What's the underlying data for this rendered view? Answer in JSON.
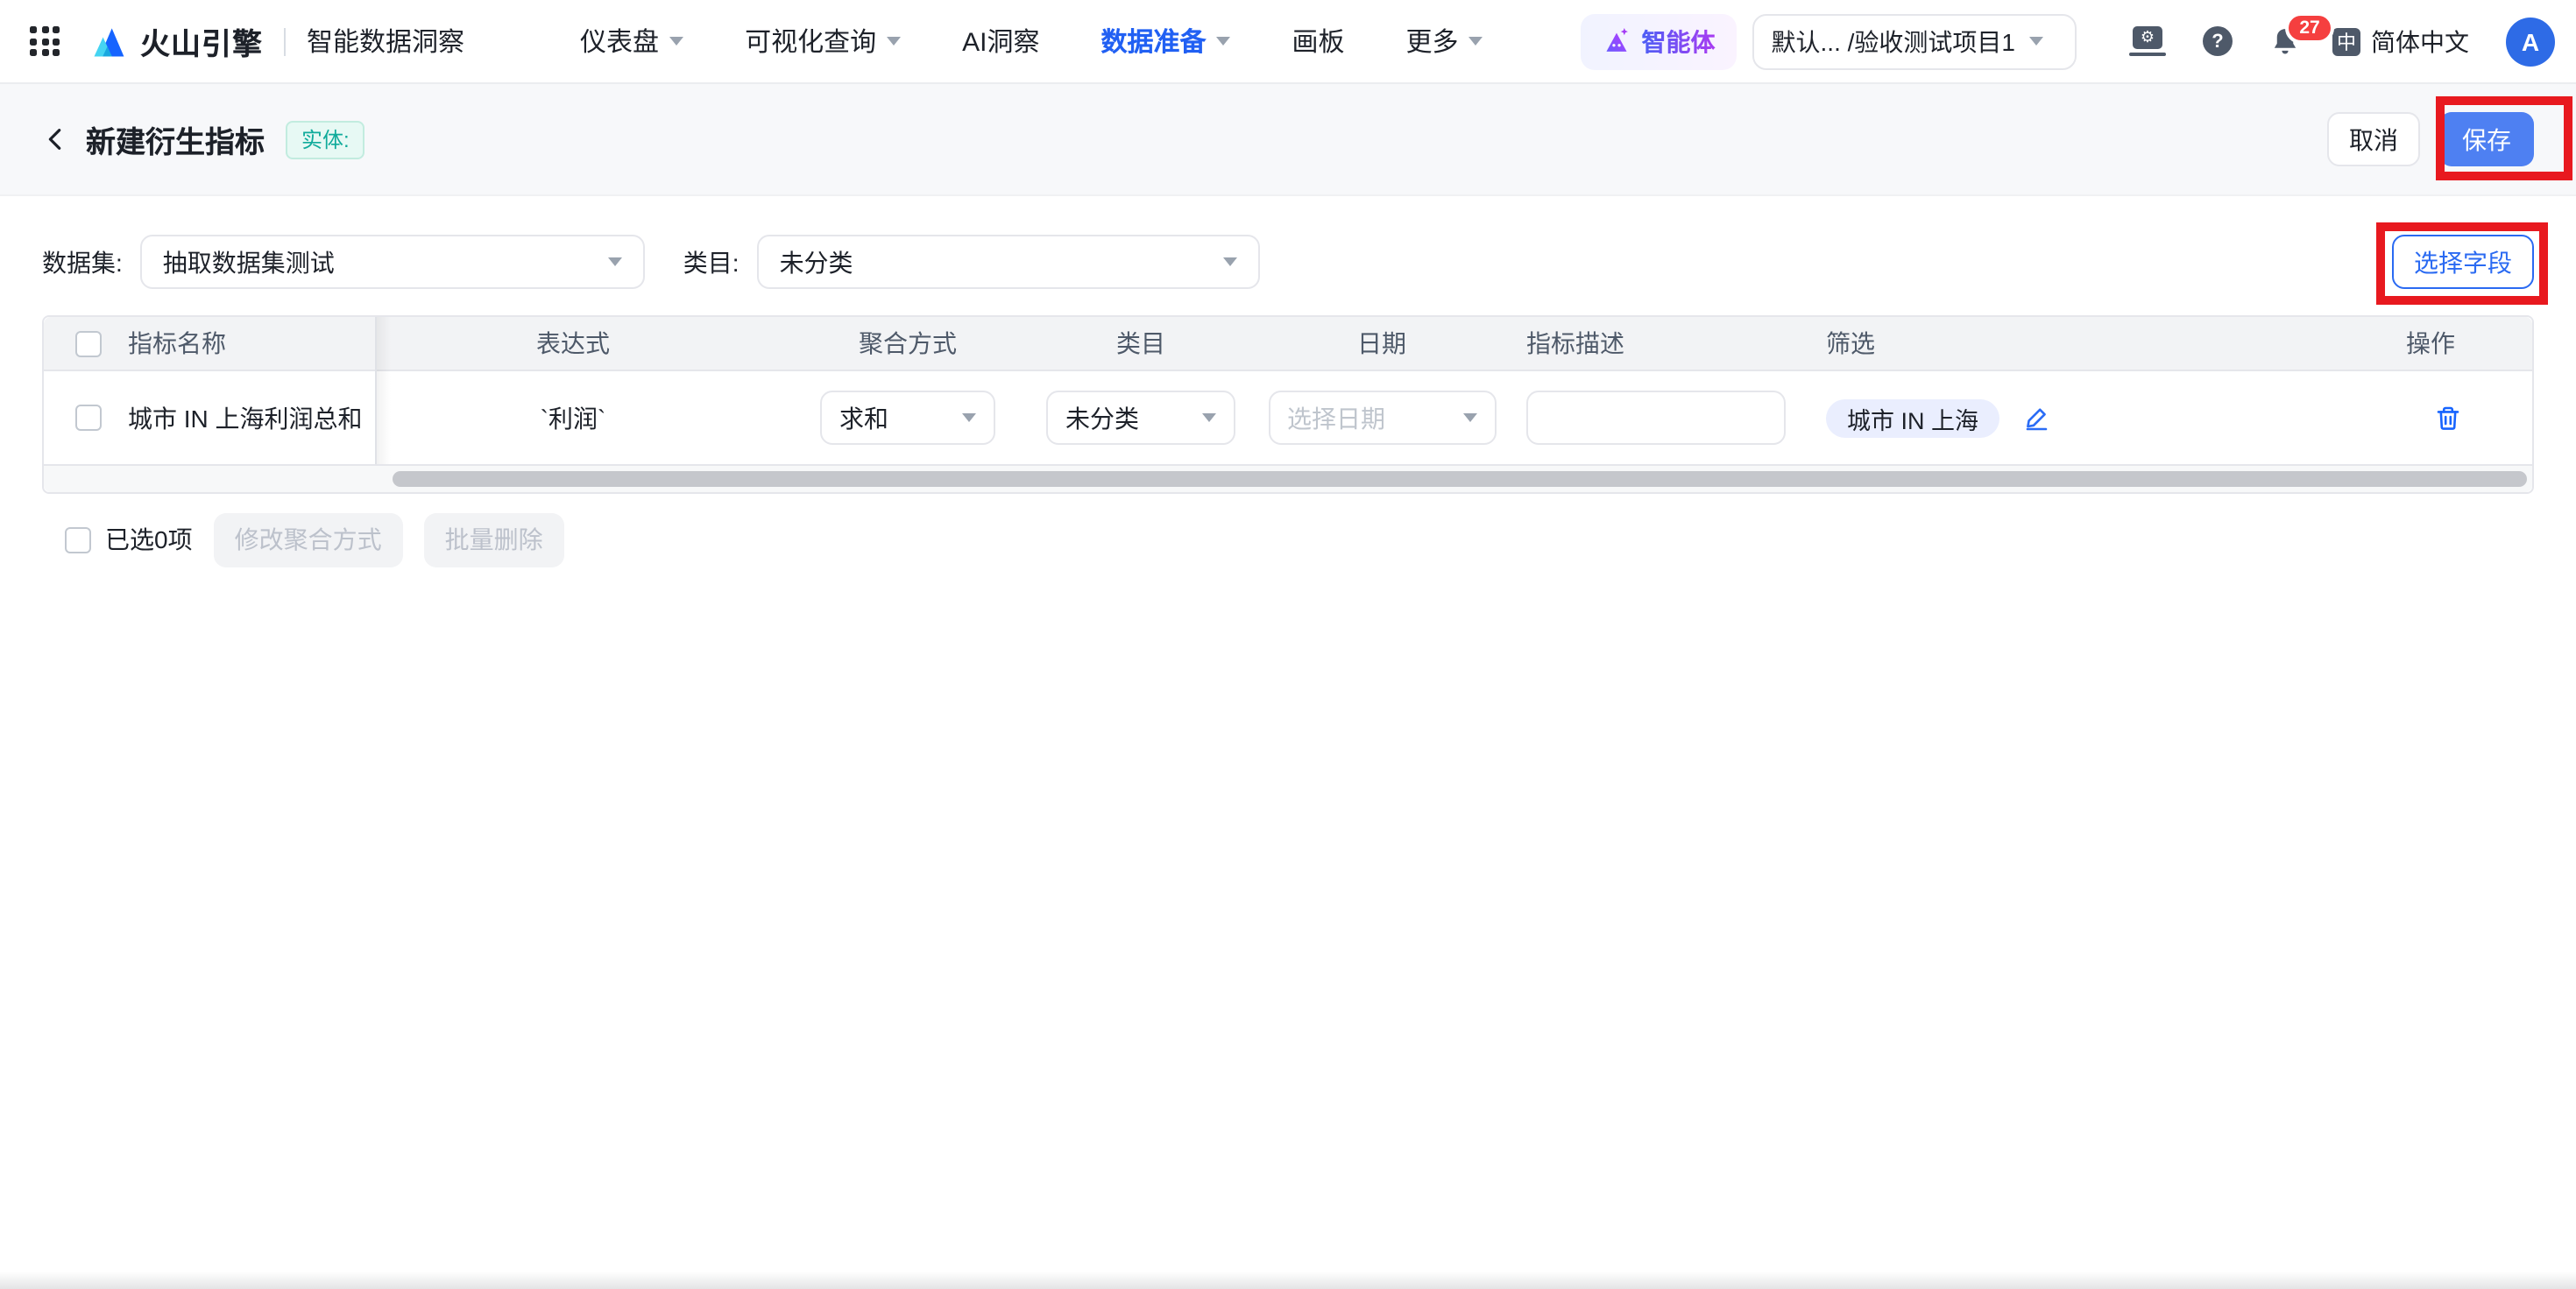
{
  "nav": {
    "brand": "火山引擎",
    "product": "智能数据洞察",
    "items": [
      {
        "label": "仪表盘"
      },
      {
        "label": "可视化查询"
      },
      {
        "label": "AI洞察"
      },
      {
        "label": "数据准备"
      },
      {
        "label": "画板"
      },
      {
        "label": "更多"
      }
    ],
    "agent_label": "智能体",
    "project_selector": "默认... /验收测试项目1",
    "notification_count": "27",
    "lang_chip": "中",
    "lang_label": "简体中文",
    "avatar_initial": "A"
  },
  "header": {
    "title": "新建衍生指标",
    "entity_badge": "实体:",
    "cancel_label": "取消",
    "save_label": "保存"
  },
  "filters": {
    "dataset_label": "数据集:",
    "dataset_value": "抽取数据集测试",
    "category_label": "类目:",
    "category_value": "未分类",
    "select_fields_label": "选择字段"
  },
  "table": {
    "columns": [
      "指标名称",
      "表达式",
      "聚合方式",
      "类目",
      "日期",
      "指标描述",
      "筛选",
      "操作"
    ],
    "rows": [
      {
        "name": "城市 IN 上海利润总和",
        "expression": "`利润`",
        "aggregation": "求和",
        "category": "未分类",
        "date_placeholder": "选择日期",
        "description": "",
        "filter_tag": "城市 IN 上海"
      }
    ]
  },
  "footer": {
    "selected_label": "已选0项",
    "modify_aggregation_label": "修改聚合方式",
    "batch_delete_label": "批量删除"
  },
  "colors": {
    "primary_blue": "#1664ff",
    "active_nav_blue": "#2160f3",
    "save_button_blue": "#4e80f2",
    "annotation_red": "#e8191f",
    "notification_red": "#f53f3f",
    "entity_badge_teal": "#10ab9b",
    "filter_tag_bg": "#eaeefe"
  }
}
